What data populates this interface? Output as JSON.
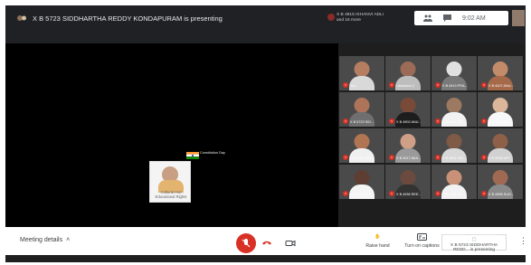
{
  "presenter": {
    "text": "X B 5723 SIDDHARTHA REDDY KONDAPURAM is presenting"
  },
  "topbar": {
    "participants_note_1": "X B 4815 ISHANVI ADLI",
    "participants_note_2": "and 16 more",
    "time": "9:02 AM"
  },
  "slide": {
    "heading": "Constitution Day",
    "thumbnail_text": "Cultural And Educational Rights"
  },
  "tiles": [
    {
      "label": "You"
    },
    {
      "label": "Lakshana C"
    },
    {
      "label": "X B 4913 PRA..."
    },
    {
      "label": "X B 4407 ANU..."
    },
    {
      "label": "X B 5723 SID..."
    },
    {
      "label": "X B 4902 ANU..."
    },
    {
      "label": "X B 4914 SR..."
    },
    {
      "label": "X B 5219 CHI..."
    },
    {
      "label": "X B 4011 ABH..."
    },
    {
      "label": "X B 4017 AKA..."
    },
    {
      "label": "X B 4651 VIB..."
    },
    {
      "label": "X B 4938 ARY..."
    },
    {
      "label": "X B 110031 P..."
    },
    {
      "label": "X B 4936 REE..."
    },
    {
      "label": "X B 1196 PR..."
    },
    {
      "label": "X B 4958 SUG..."
    }
  ],
  "bottom_bar": {
    "meeting_details": "Meeting details",
    "raise_hand": "Raise hand",
    "turn_on_captions": "Turn on captions",
    "presenting_badge": "X B 5723 SIDDHARTHA REDD... is presenting",
    "activate_windows": "Activate Windows",
    "activate_windows_sub": "Go to Settings to activate Windows."
  }
}
